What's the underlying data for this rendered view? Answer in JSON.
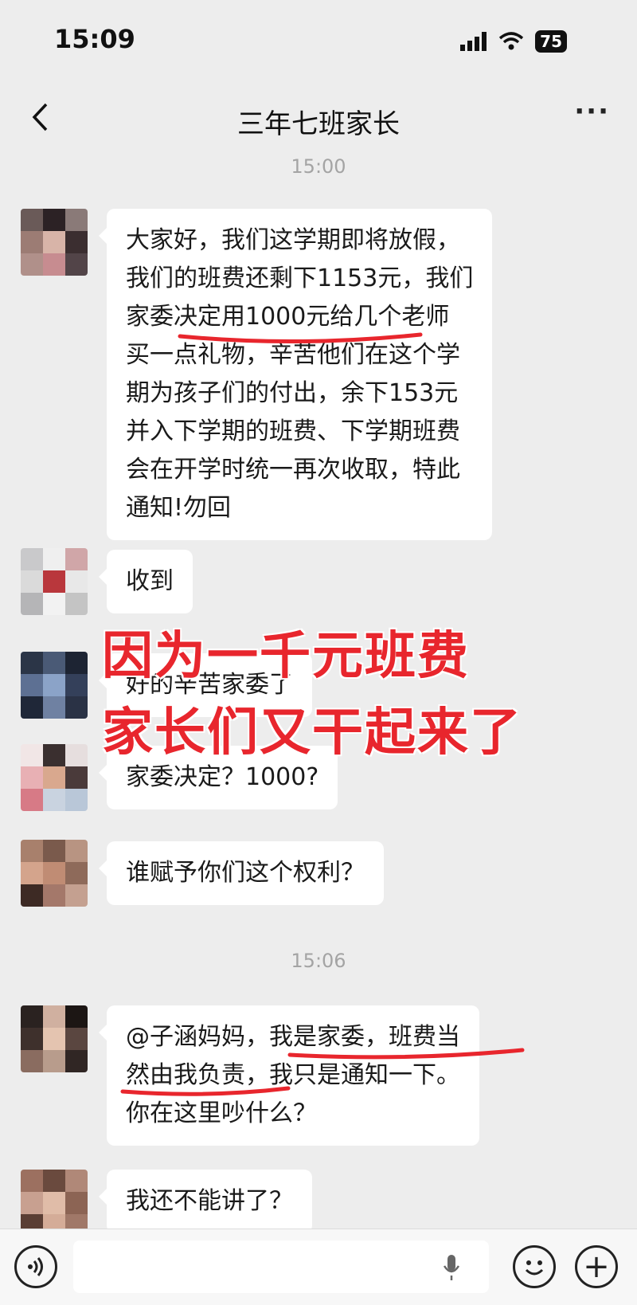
{
  "status_bar": {
    "time": "15:09",
    "battery": "75"
  },
  "header": {
    "title": "三年七班家长",
    "back_icon": "chevron-left-icon",
    "more": "···"
  },
  "timestamps": [
    "15:00",
    "15:06"
  ],
  "messages": [
    {
      "lines": [
        "大家好，我们这学期即将放假，",
        "我们的班费还剩下1153元，我们",
        "家委决定用1000元给几个老师",
        "买一点礼物，辛苦他们在这个学",
        "期为孩子们的付出，余下153元",
        "并入下学期的班费、下学期班费",
        "会在开学时统一再次收取，特此",
        "通知!勿回"
      ]
    },
    {
      "lines": [
        "收到"
      ]
    },
    {
      "lines": [
        "好的辛苦家委了"
      ]
    },
    {
      "lines": [
        "家委决定？1000?"
      ]
    },
    {
      "lines": [
        "谁赋予你们这个权利？"
      ]
    },
    {
      "lines": [
        "@子涵妈妈，我是家委，班费当",
        "然由我负责，我只是通知一下。",
        "你在这里吵什么？"
      ]
    },
    {
      "lines": [
        "我还不能讲了？"
      ]
    }
  ],
  "overlay": {
    "line1": "因为一千元班费",
    "line2": "家长们又干起来了",
    "color": "#e8262d"
  },
  "input_bar": {
    "voice_icon": "voice-icon",
    "mic_icon": "mic-icon",
    "emoji_icon": "emoji-icon",
    "plus": "+"
  }
}
